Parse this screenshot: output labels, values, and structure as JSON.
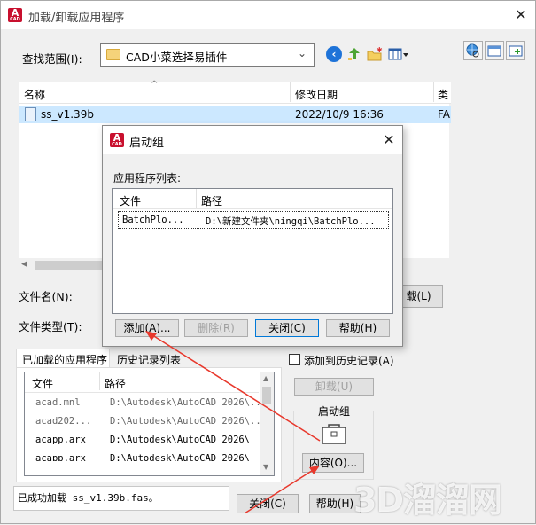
{
  "window": {
    "title": "加载/卸载应用程序"
  },
  "lookin": {
    "label": "查找范围(I):",
    "value": "CAD小菜选择易插件"
  },
  "file_list": {
    "columns": [
      "名称",
      "修改日期",
      "类"
    ],
    "rows": [
      {
        "name": "ss_v1.39b",
        "date": "2022/10/9 16:36",
        "type": "FA"
      }
    ]
  },
  "filename": {
    "label": "文件名(N):"
  },
  "filetype": {
    "label": "文件类型(T):"
  },
  "load_button": "载(L)",
  "tabs": {
    "loaded": "已加载的应用程序",
    "history": "历史记录列表"
  },
  "add_history": {
    "label": "添加到历史记录(A)"
  },
  "loaded_list": {
    "columns": [
      "文件",
      "路径"
    ],
    "rows": [
      {
        "file": "acad.mnl",
        "path": "D:\\Autodesk\\AutoCAD 2026\\..."
      },
      {
        "file": "acad202...",
        "path": "D:\\Autodesk\\AutoCAD 2026\\..."
      },
      {
        "file": "acapp.arx",
        "path": "D:\\Autodesk\\AutoCAD 2026\\"
      },
      {
        "file": "acapp.arx",
        "path": "D:\\Autodesk\\AutoCAD 2026\\"
      }
    ]
  },
  "unload_button": "卸载(U)",
  "startup_suite": {
    "label": "启动组",
    "contents_button": "内容(O)..."
  },
  "status": "已成功加载 ss_v1.39b.fas。",
  "close_button": "关闭(C)",
  "help_button": "帮助(H)",
  "dialog": {
    "title": "启动组",
    "list_label": "应用程序列表:",
    "columns": [
      "文件",
      "路径"
    ],
    "rows": [
      {
        "file": "BatchPlo...",
        "path": "D:\\新建文件夹\\ningqi\\BatchPlo..."
      }
    ],
    "add_button": "添加(A)...",
    "remove_button": "删除(R)",
    "close_button": "关闭(C)",
    "help_button": "帮助(H)"
  },
  "watermark": "3D溜溜网",
  "colors": {
    "accent": "#0078d7",
    "annotation": "#e8382c",
    "selection": "#cce8ff"
  }
}
